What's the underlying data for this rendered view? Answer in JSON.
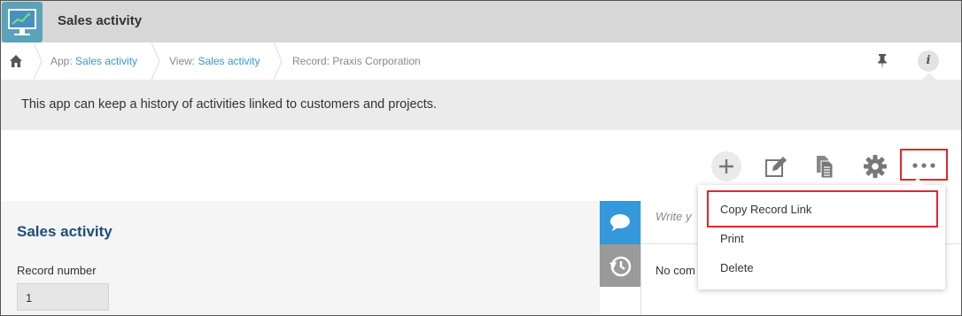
{
  "header": {
    "title": "Sales activity"
  },
  "breadcrumb": {
    "app_prefix": "App: ",
    "app_link": "Sales activity",
    "view_prefix": "View: ",
    "view_link": "Sales activity",
    "record_text": "Record: Praxis Corporation"
  },
  "description": {
    "text": "This app can keep a history of activities linked to customers and projects."
  },
  "toolbar": {
    "icons": [
      "add-icon",
      "edit-icon",
      "duplicate-icon",
      "gear-icon",
      "more-icon"
    ]
  },
  "record": {
    "section_title": "Sales activity",
    "record_number_label": "Record number",
    "record_number_value": "1"
  },
  "sidebar": {
    "comment_placeholder": "Write y",
    "no_comments_text": "No com"
  },
  "menu": {
    "items": [
      {
        "label": "Copy Record Link"
      },
      {
        "label": "Print"
      },
      {
        "label": "Delete"
      }
    ]
  },
  "colors": {
    "accent": "#3498db",
    "highlight": "#e0282a",
    "title": "#1f4e79"
  }
}
